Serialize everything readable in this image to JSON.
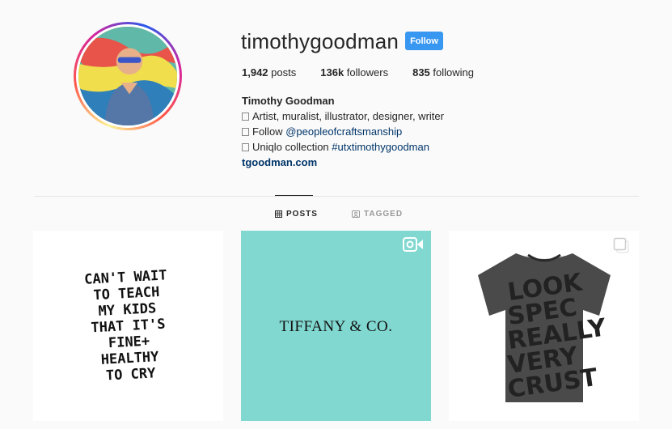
{
  "profile": {
    "username": "timothygoodman",
    "follow_label": "Follow",
    "stats": {
      "posts_count": "1,942",
      "posts_label": "posts",
      "followers_count": "136k",
      "followers_label": "followers",
      "following_count": "835",
      "following_label": "following"
    },
    "bio": {
      "full_name": "Timothy Goodman",
      "line1": "Artist, muralist, illustrator, designer, writer",
      "line2_prefix": "Follow ",
      "line2_mention": "@peopleofcraftsmanship",
      "line3_prefix": "Uniqlo collection ",
      "line3_hashtag": "#utxtimothygoodman",
      "website": "tgoodman.com"
    }
  },
  "tabs": {
    "posts": "POSTS",
    "tagged": "TAGGED"
  },
  "posts": {
    "post1_text": [
      "CAN'T WAIT",
      "TO TEACH",
      "MY KIDS",
      "THAT IT'S",
      "FINE+",
      "HEALTHY",
      "TO CRY"
    ],
    "post2_text": "TIFFANY & CO.",
    "post3_shirt_text": [
      "LOOK",
      "SPEC",
      "REALLY",
      "VERY",
      "CRUST"
    ]
  },
  "colors": {
    "follow_button": "#3897f0",
    "link": "#003569",
    "tiffany_blue": "#81d8d0"
  },
  "icons": {
    "posts_tab": "grid-icon",
    "tagged_tab": "tag-icon",
    "video": "video-icon",
    "carousel": "carousel-icon"
  }
}
